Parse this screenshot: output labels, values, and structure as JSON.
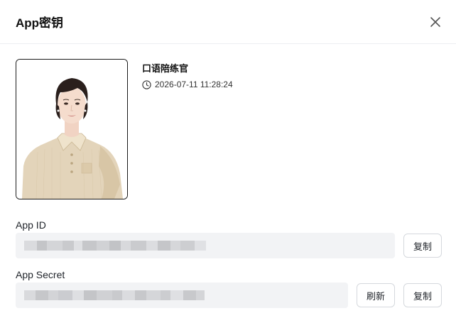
{
  "dialog": {
    "title": "App密钥"
  },
  "agent": {
    "name": "口语陪练官",
    "created_at": "2026-07-11 11:28:24"
  },
  "fields": {
    "app_id": {
      "label": "App ID",
      "copy_label": "复制"
    },
    "app_secret": {
      "label": "App Secret",
      "refresh_label": "刷新",
      "copy_label": "复制"
    }
  },
  "icons": {
    "close": "close-icon",
    "clock": "clock-icon"
  },
  "colors": {
    "field_bg": "#f2f3f5",
    "border": "#d5d8dd",
    "text": "#1f2329"
  }
}
